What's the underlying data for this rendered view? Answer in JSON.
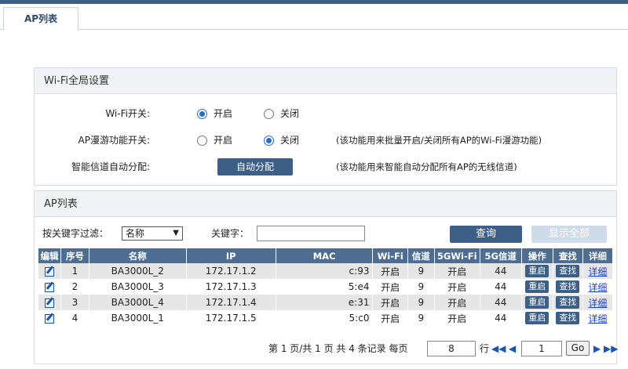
{
  "tabs": {
    "active": "AP列表"
  },
  "wifi_panel": {
    "title": "Wi-Fi全局设置",
    "wifi_switch": {
      "label": "Wi-Fi开关:",
      "on": "开启",
      "off": "关闭",
      "selected": "on"
    },
    "roaming": {
      "label": "AP漫游功能开关:",
      "on": "开启",
      "off": "关闭",
      "selected": "off",
      "note": "(该功能用来批量开启/关闭所有AP的Wi-Fi漫游功能)"
    },
    "channel": {
      "label": "智能信道自动分配:",
      "button": "自动分配",
      "note": "(该功能用来智能自动分配所有AP的无线信道)"
    }
  },
  "ap_panel": {
    "title": "AP列表",
    "filter": {
      "label": "按关键字过滤：",
      "select_value": "名称",
      "keyword_label": "关键字：",
      "keyword_value": "",
      "query_button": "查询",
      "show_all_button": "显示全部"
    },
    "columns": [
      "编辑",
      "序号",
      "名称",
      "IP",
      "MAC",
      "Wi-Fi",
      "信道",
      "5GWi-Fi",
      "5G信道",
      "操作",
      "查找",
      "详细"
    ],
    "rows": [
      {
        "index": "1",
        "name": "BA3000L_2",
        "ip": "172.17.1.2",
        "mac": "c:93",
        "wifi": "开启",
        "channel": "9",
        "wifi5g": "开启",
        "channel5g": "44",
        "op": "重启",
        "find": "查找",
        "detail": "详细"
      },
      {
        "index": "2",
        "name": "BA3000L_3",
        "ip": "172.17.1.3",
        "mac": "5:e4",
        "wifi": "开启",
        "channel": "9",
        "wifi5g": "开启",
        "channel5g": "44",
        "op": "重启",
        "find": "查找",
        "detail": "详细"
      },
      {
        "index": "3",
        "name": "BA3000L_4",
        "ip": "172.17.1.4",
        "mac": "e:31",
        "wifi": "开启",
        "channel": "9",
        "wifi5g": "开启",
        "channel5g": "44",
        "op": "重启",
        "find": "查找",
        "detail": "详细"
      },
      {
        "index": "4",
        "name": "BA3000L_1",
        "ip": "172.17.1.5",
        "mac": "5:c0",
        "wifi": "开启",
        "channel": "9",
        "wifi5g": "开启",
        "channel5g": "44",
        "op": "重启",
        "find": "查找",
        "detail": "详细"
      }
    ],
    "pager": {
      "summary": "第 1 页/共 1 页 共 4 条记录 每页",
      "per_page": "8",
      "rows_unit": "行",
      "page": "1",
      "go": "Go"
    }
  },
  "colors": {
    "accent": "#3d5f86",
    "header": "#4d6e92",
    "link": "#1a3fd6"
  }
}
